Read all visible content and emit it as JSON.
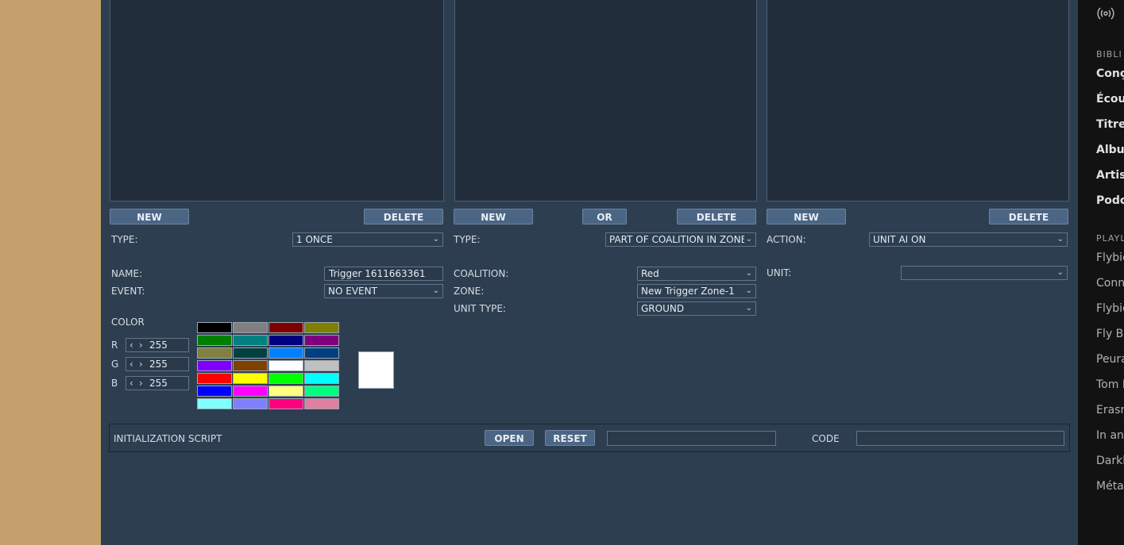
{
  "conditions_panel": {
    "new_label": "NEW",
    "or_label": "OR",
    "delete_label": "DELETE",
    "type_label": "TYPE:",
    "type_value": "PART OF COALITION IN ZONE",
    "coalition_label": "COALITION:",
    "coalition_value": "Red",
    "zone_label": "ZONE:",
    "zone_value": "New Trigger Zone-1",
    "unit_type_label": "UNIT TYPE:",
    "unit_type_value": "GROUND"
  },
  "triggers_panel": {
    "new_label": "NEW",
    "delete_label": "DELETE",
    "type_label": "TYPE:",
    "type_value": "1 ONCE",
    "name_label": "NAME:",
    "name_value": "Trigger 1611663361",
    "event_label": "EVENT:",
    "event_value": "NO EVENT",
    "color_label": "COLOR",
    "r_label": "R",
    "g_label": "G",
    "b_label": "B",
    "r_value": "255",
    "g_value": "255",
    "b_value": "255",
    "current_color": "#ffffff",
    "palette": [
      [
        "#000000",
        "#808080",
        "#800000",
        "#808000"
      ],
      [
        "#008000",
        "#008080",
        "#000080",
        "#800080"
      ],
      [
        "#808040",
        "#004040",
        "#0080ff",
        "#004080"
      ],
      [
        "#8000ff",
        "#804000",
        "#ffffff",
        "#c0c0c0"
      ],
      [
        "#ff0000",
        "#ffff00",
        "#00ff00",
        "#00ffff"
      ],
      [
        "#0000ff",
        "#ff00ff",
        "#ffff80",
        "#00ff80"
      ],
      [
        "#80ffff",
        "#8080ff",
        "#ff0080",
        "#e080a0"
      ]
    ]
  },
  "actions_panel": {
    "new_label": "NEW",
    "delete_label": "DELETE",
    "action_label": "ACTION:",
    "action_value": "UNIT AI ON",
    "unit_label": "UNIT:",
    "unit_value": ""
  },
  "init_script": {
    "label": "INITIALIZATION SCRIPT",
    "open_label": "OPEN",
    "reset_label": "RESET",
    "file_value": "",
    "code_label": "CODE",
    "code_value": ""
  },
  "sidebar": {
    "library_header": "BIBLI",
    "library_items": [
      "Conç",
      "Écou",
      "Titres",
      "Albu",
      "Artist",
      "Podc"
    ],
    "playlists_header": "PLAYL",
    "playlists": [
      "Flybie",
      "Conn",
      "Flybie",
      "Fly Bi",
      "Peura",
      "Tom K",
      "Erasn",
      "In anc",
      "Darkb",
      "Métal"
    ]
  },
  "colors": {
    "editor_bg": "#2d3e50",
    "list_bg": "#222d3b",
    "button_bg": "#4b6584",
    "side_bg": "#121212",
    "left_strip": "#c4a06d"
  }
}
